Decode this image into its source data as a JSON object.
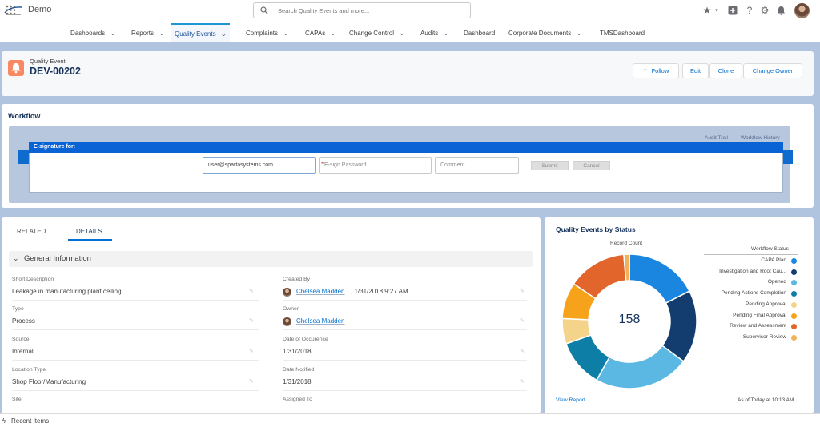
{
  "header": {
    "search_placeholder": "Search Quality Events and more...",
    "icons": [
      "star-icon",
      "chevron-down-icon",
      "plus-icon",
      "help-icon",
      "setup-gear-icon",
      "notifications-bell-icon"
    ]
  },
  "nav": {
    "app_name": "Demo",
    "tabs": [
      {
        "label": "Dashboards",
        "chevron": true
      },
      {
        "label": "Reports",
        "chevron": true
      },
      {
        "label": "Quality Events",
        "chevron": true,
        "active": true
      },
      {
        "label": "Complaints",
        "chevron": true
      },
      {
        "label": "CAPAs",
        "chevron": true
      },
      {
        "label": "Change Control",
        "chevron": true
      },
      {
        "label": "Audits",
        "chevron": true
      },
      {
        "label": "Dashboard",
        "chevron": false
      },
      {
        "label": "Corporate Documents",
        "chevron": true
      },
      {
        "label": "TMSDashboard",
        "chevron": false
      }
    ]
  },
  "record": {
    "type": "Quality Event",
    "name": "DEV-00202",
    "buttons": [
      "Follow",
      "Edit",
      "Clone",
      "Change Owner"
    ],
    "follow_icon": "+"
  },
  "workflow": {
    "title": "Workflow",
    "links": [
      "Audit Trail",
      "Workflow History"
    ],
    "esignature": {
      "title": "E-signature for:",
      "username": "user@spartasystems.com",
      "password_placeholder": "E-sign Password",
      "required_mark": "*",
      "comment_placeholder": "Comment",
      "submit": "Submit",
      "cancel": "Cancel"
    }
  },
  "details": {
    "tabs": [
      "RELATED",
      "DETAILS"
    ],
    "active_tab": "DETAILS",
    "section_title": "General Information",
    "left_fields": [
      {
        "label": "Short Description",
        "value": "Leakage in manufacturing plant ceiling"
      },
      {
        "label": "Type",
        "value": "Process"
      },
      {
        "label": "Source",
        "value": "Internal"
      },
      {
        "label": "Location Type",
        "value": "Shop Floor/Manufacturing"
      },
      {
        "label": "Site",
        "value": ""
      }
    ],
    "right_fields": [
      {
        "label": "Created By",
        "value": "Chelsea Madden",
        "suffix": ", 1/31/2018 9:27 AM",
        "link": true
      },
      {
        "label": "Owner",
        "value": "Chelsea Madden",
        "suffix": "",
        "link": true
      },
      {
        "label": "Date of Occurence",
        "value": "1/31/2018",
        "suffix": "",
        "link": false
      },
      {
        "label": "Date Notified",
        "value": "1/31/2018",
        "suffix": "",
        "link": false
      },
      {
        "label": "Assigned To",
        "value": "",
        "suffix": "",
        "link": false
      }
    ]
  },
  "report": {
    "title": "Quality Events by Status",
    "record_count_label": "Record Count",
    "total": "158",
    "legend_title": "Workflow Status",
    "view_report": "View Report",
    "as_of": "As of Today at 10:13 AM"
  },
  "chart_data": {
    "type": "pie",
    "donut": true,
    "title": "Quality Events by Status",
    "value_label": "Record Count",
    "legend_title": "Workflow Status",
    "total": 158,
    "series": [
      {
        "name": "CAPA Plan",
        "value": 26,
        "color": "#1b86e0"
      },
      {
        "name": "Investigation and Root Cau...",
        "value": 26,
        "color": "#123d6e"
      },
      {
        "name": "Opened",
        "value": 34,
        "color": "#5bb8e2"
      },
      {
        "name": "Pending Actions Completion",
        "value": 17,
        "color": "#0d7ea6"
      },
      {
        "name": "Pending Approval",
        "value": 9,
        "color": "#f4d48a"
      },
      {
        "name": "Pending Final Approval",
        "value": 13,
        "color": "#f7a21b"
      },
      {
        "name": "Review and Assessment",
        "value": 21,
        "color": "#e2652b"
      },
      {
        "name": "Supervisor Review",
        "value": 2,
        "color": "#f2b25c"
      }
    ]
  },
  "footer": {
    "recent_items": "Recent Items"
  }
}
